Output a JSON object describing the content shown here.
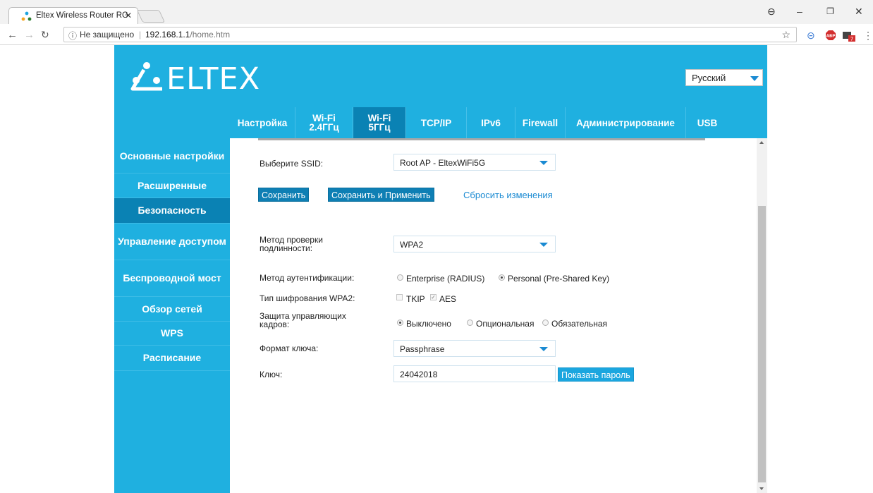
{
  "browser": {
    "tab_title": "Eltex Wireless Router RG-",
    "tab_close": "✕",
    "security_label": "Не защищено",
    "url_host": "192.168.1.1",
    "url_path": "/home.htm",
    "ext_badge": "7"
  },
  "header": {
    "language": "Русский"
  },
  "topnav": [
    {
      "label": "Настройка"
    },
    {
      "label": "Wi-Fi 2.4ГГц"
    },
    {
      "label": "Wi-Fi 5ГГц"
    },
    {
      "label": "TCP/IP"
    },
    {
      "label": "IPv6"
    },
    {
      "label": "Firewall"
    },
    {
      "label": "Администрирование"
    },
    {
      "label": "USB"
    }
  ],
  "sidebar": [
    {
      "label": "Основные настройки"
    },
    {
      "label": "Расширенные"
    },
    {
      "label": "Безопасность"
    },
    {
      "label": "Управление доступом"
    },
    {
      "label": "Беспроводной мост"
    },
    {
      "label": "Обзор сетей"
    },
    {
      "label": "WPS"
    },
    {
      "label": "Расписание"
    }
  ],
  "form": {
    "ssid_label": "Выберите SSID:",
    "ssid_value": "Root AP - EltexWiFi5G",
    "save_label": "Сохранить",
    "save_apply_label": "Сохранить и Применить",
    "reset_label": "Сбросить изменения",
    "auth_check_label": "Метод проверки подлинности:",
    "auth_check_value": "WPA2",
    "auth_method_label": "Метод аутентификации:",
    "auth_enterprise": "Enterprise (RADIUS)",
    "auth_personal": "Personal (Pre-Shared Key)",
    "cipher_label": "Тип шифрования WPA2:",
    "cipher_tkip": "TKIP",
    "cipher_aes": "AES",
    "mgmt_label": "Защита управляющих кадров:",
    "mgmt_off": "Выключено",
    "mgmt_optional": "Опциональная",
    "mgmt_required": "Обязательная",
    "key_format_label": "Формат ключа:",
    "key_format_value": "Passphrase",
    "key_label": "Ключ:",
    "key_value": "24042018",
    "show_password_label": "Показать пароль"
  }
}
